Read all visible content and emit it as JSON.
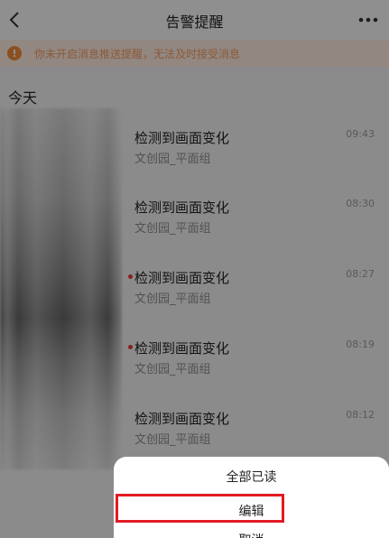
{
  "header": {
    "title": "告警提醒",
    "back_icon": "chevron-left-icon",
    "more_icon": "more-horizontal-icon"
  },
  "banner": {
    "icon": "warning-icon",
    "text": "你未开启消息推送提醒，无法及时接受消息",
    "color": "#f29b61"
  },
  "section": {
    "label": "今天"
  },
  "alerts": [
    {
      "title": "检测到画面变化",
      "subtitle": "文创园_平面组",
      "time": "09:43",
      "unread": false
    },
    {
      "title": "检测到画面变化",
      "subtitle": "文创园_平面组",
      "time": "08:30",
      "unread": false
    },
    {
      "title": "检测到画面变化",
      "subtitle": "文创园_平面组",
      "time": "08:27",
      "unread": true
    },
    {
      "title": "检测到画面变化",
      "subtitle": "文创园_平面组",
      "time": "08:19",
      "unread": true
    },
    {
      "title": "检测到画面变化",
      "subtitle": "文创园_平面组",
      "time": "08:12",
      "unread": false
    }
  ],
  "action_sheet": {
    "options": [
      "全部已读",
      "编辑",
      "取消"
    ],
    "highlight_color": "#e21b22"
  },
  "colors": {
    "unread_dot": "#e53935",
    "warning": "#f08a3c"
  }
}
